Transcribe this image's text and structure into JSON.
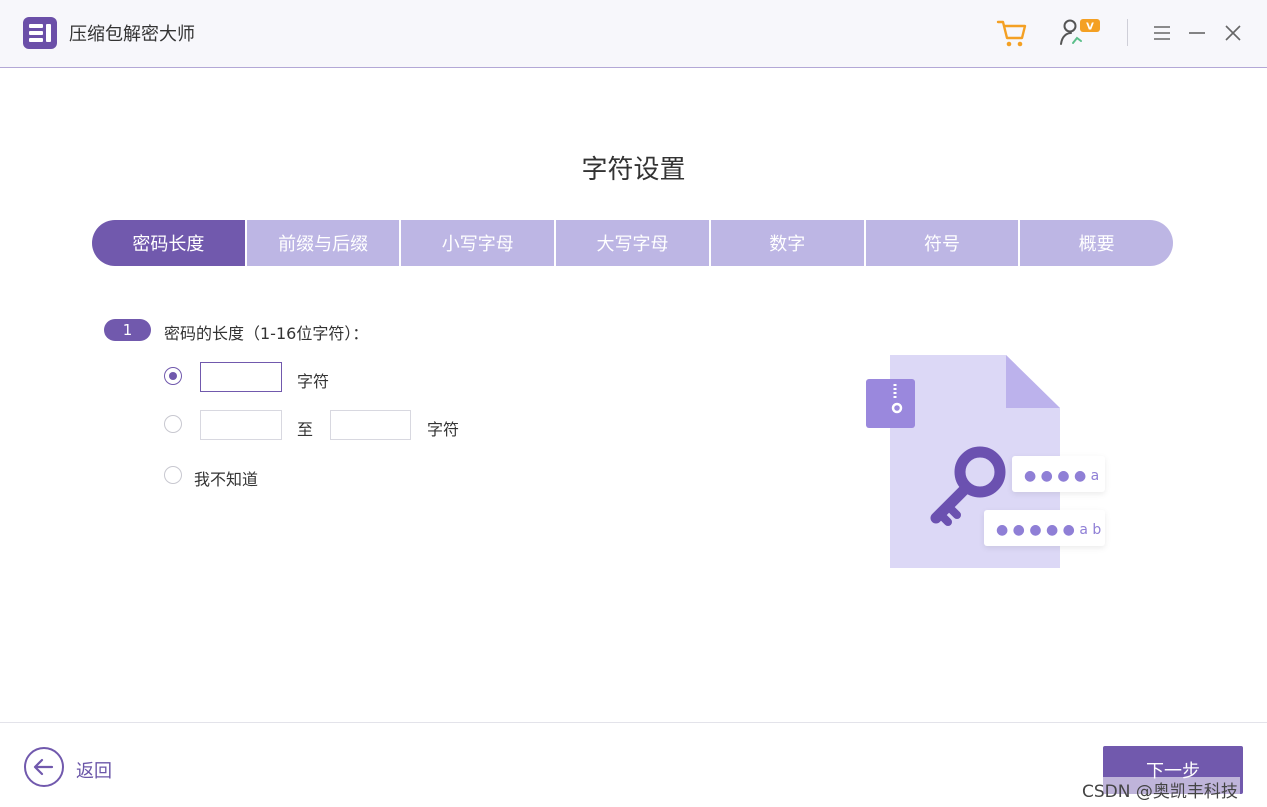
{
  "app": {
    "title": "压缩包解密大师"
  },
  "page": {
    "title": "字符设置"
  },
  "tabs": [
    {
      "label": "密码长度",
      "active": true
    },
    {
      "label": "前缀与后缀",
      "active": false
    },
    {
      "label": "小写字母",
      "active": false
    },
    {
      "label": "大写字母",
      "active": false
    },
    {
      "label": "数字",
      "active": false
    },
    {
      "label": "符号",
      "active": false
    },
    {
      "label": "概要",
      "active": false
    }
  ],
  "step": {
    "number": "1",
    "label": "密码的长度（1-16位字符）："
  },
  "options": {
    "fixed": {
      "unit": "字符",
      "value": "",
      "checked": true
    },
    "range": {
      "from_value": "",
      "to_label": "至",
      "to_value": "",
      "unit": "字符",
      "checked": false
    },
    "unknown": {
      "label": "我不知道",
      "checked": false
    }
  },
  "illustration": {
    "pwd1": "● ● ● ● a",
    "pwd2": "● ● ● ● ● a b"
  },
  "footer": {
    "back_label": "返回",
    "next_label": "下一步"
  },
  "watermark": "CSDN @奥凯丰科技",
  "colors": {
    "accent": "#7159ad",
    "tab_inactive": "#bdb6e4",
    "cart": "#f4a023",
    "vip_badge": "#f4a023"
  }
}
